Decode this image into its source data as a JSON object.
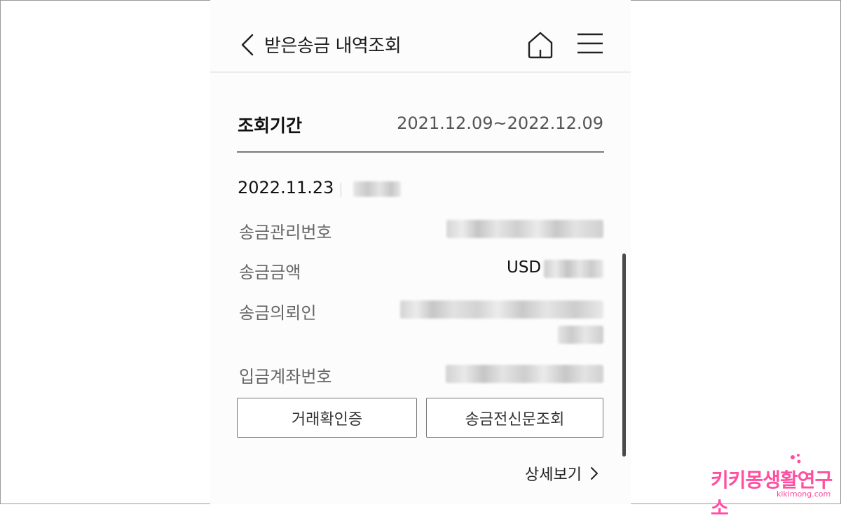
{
  "header": {
    "title": "받은송금 내역조회"
  },
  "period": {
    "label": "조회기간",
    "value": "2021.12.09~2022.12.09"
  },
  "record": {
    "date": "2022.11.23",
    "rows": [
      {
        "label": "송금관리번호"
      },
      {
        "label": "송금금액",
        "currency": "USD"
      },
      {
        "label": "송금의뢰인"
      },
      {
        "label": "입금계좌번호"
      }
    ]
  },
  "buttons": {
    "confirm": "거래확인증",
    "inquiry": "송금전신문조회"
  },
  "more": {
    "label": "상세보기"
  },
  "watermark": {
    "main": "키키몽생활연구소",
    "sub": "kikimong.com"
  },
  "icons": [
    "back-arrow-icon",
    "home-icon",
    "hamburger-menu-icon",
    "chevron-right-icon"
  ],
  "colors": {
    "accent_watermark": "#ff4fa0",
    "divider": "#7a7a7a"
  }
}
